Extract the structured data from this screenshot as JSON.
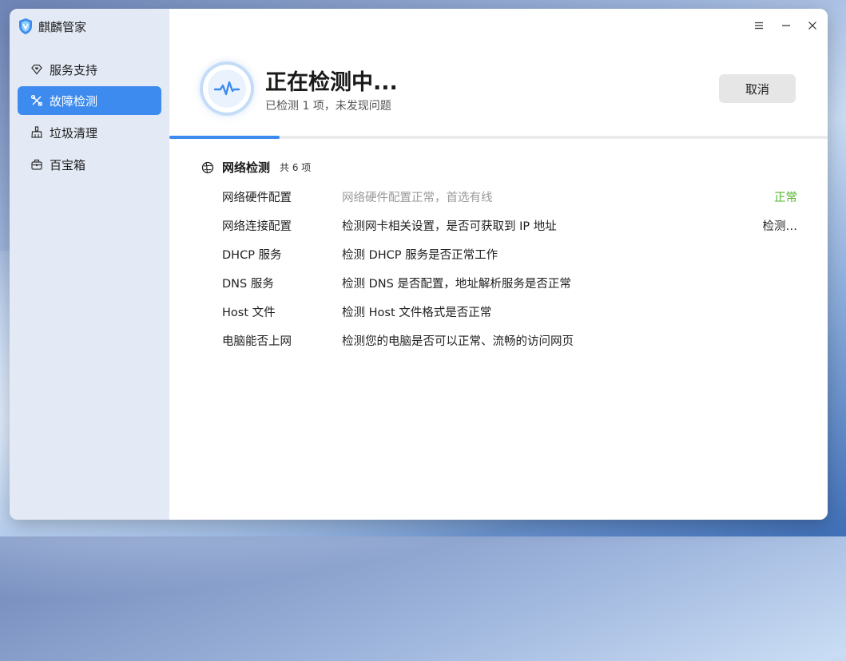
{
  "app": {
    "name": "麒麟管家"
  },
  "sidebar": {
    "items": [
      {
        "label": "服务支持",
        "icon": "diamond-heart-icon",
        "active": false
      },
      {
        "label": "故障检测",
        "icon": "tools-icon",
        "active": true
      },
      {
        "label": "垃圾清理",
        "icon": "broom-icon",
        "active": false
      },
      {
        "label": "百宝箱",
        "icon": "toolbox-icon",
        "active": false
      }
    ]
  },
  "header": {
    "title": "正在检测中...",
    "subtitle": "已检测 1 项，未发现问题",
    "cancel_label": "取消",
    "progress": 0.167
  },
  "section": {
    "title": "网络检测",
    "count": "共 6 项"
  },
  "rows": [
    {
      "name": "网络硬件配置",
      "desc": "网络硬件配置正常，首选有线",
      "status": "正常"
    },
    {
      "name": "网络连接配置",
      "desc": "检测网卡相关设置，是否可获取到 IP 地址",
      "status": "检测…"
    },
    {
      "name": "DHCP 服务",
      "desc": "检测 DHCP 服务是否正常工作",
      "status": ""
    },
    {
      "name": "DNS 服务",
      "desc": "检测 DNS 是否配置，地址解析服务是否正常",
      "status": ""
    },
    {
      "name": "Host 文件",
      "desc": "检测 Host 文件格式是否正常",
      "status": ""
    },
    {
      "name": "电脑能否上网",
      "desc": "检测您的电脑是否可以正常、流畅的访问网页",
      "status": ""
    }
  ],
  "colors": {
    "accent": "#3d8bef",
    "ok": "#52b62c"
  }
}
